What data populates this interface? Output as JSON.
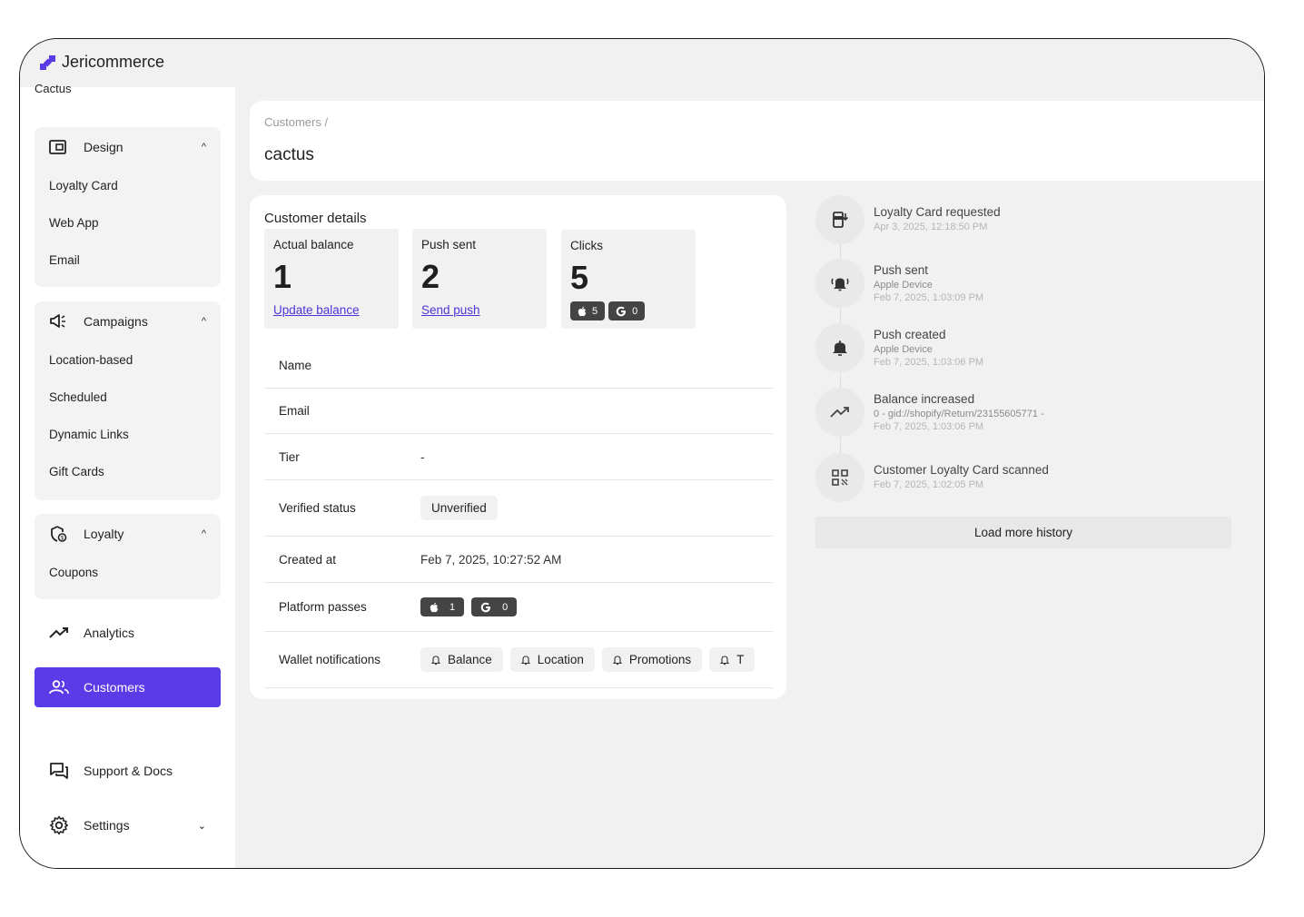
{
  "app": {
    "brand": "Jericommerce",
    "store": "Cactus"
  },
  "sidebar": {
    "design": {
      "label": "Design",
      "items": [
        "Loyalty Card",
        "Web App",
        "Email"
      ]
    },
    "campaigns": {
      "label": "Campaigns",
      "items": [
        "Location-based",
        "Scheduled",
        "Dynamic Links",
        "Gift Cards"
      ]
    },
    "loyalty": {
      "label": "Loyalty",
      "items": [
        "Coupons"
      ]
    },
    "analytics": "Analytics",
    "customers": "Customers",
    "support": "Support & Docs",
    "settings": "Settings"
  },
  "header": {
    "breadcrumb": "Customers /",
    "title": "cactus"
  },
  "details": {
    "title": "Customer details",
    "stats": {
      "balance": {
        "label": "Actual balance",
        "value": "1",
        "link": "Update balance"
      },
      "push": {
        "label": "Push sent",
        "value": "2",
        "link": "Send push"
      },
      "clicks": {
        "label": "Clicks",
        "value": "5",
        "apple": "5",
        "google": "0"
      }
    },
    "rows": {
      "name": {
        "label": "Name",
        "value": ""
      },
      "email": {
        "label": "Email",
        "value": ""
      },
      "tier": {
        "label": "Tier",
        "value": "-"
      },
      "verified": {
        "label": "Verified status",
        "value": "Unverified"
      },
      "created": {
        "label": "Created at",
        "value": "Feb 7, 2025, 10:27:52 AM"
      },
      "passes": {
        "label": "Platform passes",
        "apple": "1",
        "google": "0"
      },
      "notifications": {
        "label": "Wallet notifications",
        "items": [
          "Balance",
          "Location",
          "Promotions",
          "T"
        ]
      }
    }
  },
  "history": {
    "events": [
      {
        "title": "Loyalty Card requested",
        "sub": "",
        "date": "Apr 3, 2025, 12:18:50 PM",
        "icon": "card-download-icon"
      },
      {
        "title": "Push sent",
        "sub": "Apple Device",
        "date": "Feb 7, 2025, 1:03:09 PM",
        "icon": "bell-ringing-icon"
      },
      {
        "title": "Push created",
        "sub": "Apple Device",
        "date": "Feb 7, 2025, 1:03:06 PM",
        "icon": "bell-icon"
      },
      {
        "title": "Balance increased",
        "sub": "0 - gid://shopify/Return/23155605771 -",
        "date": "Feb 7, 2025, 1:03:06 PM",
        "icon": "trending-up-icon"
      },
      {
        "title": "Customer Loyalty Card scanned",
        "sub": "",
        "date": "Feb 7, 2025, 1:02:05 PM",
        "icon": "qr-code-icon"
      }
    ],
    "load_more": "Load more history"
  },
  "colors": {
    "accent": "#5b3ae8",
    "link": "#4a35d6",
    "chip": "#444444"
  }
}
